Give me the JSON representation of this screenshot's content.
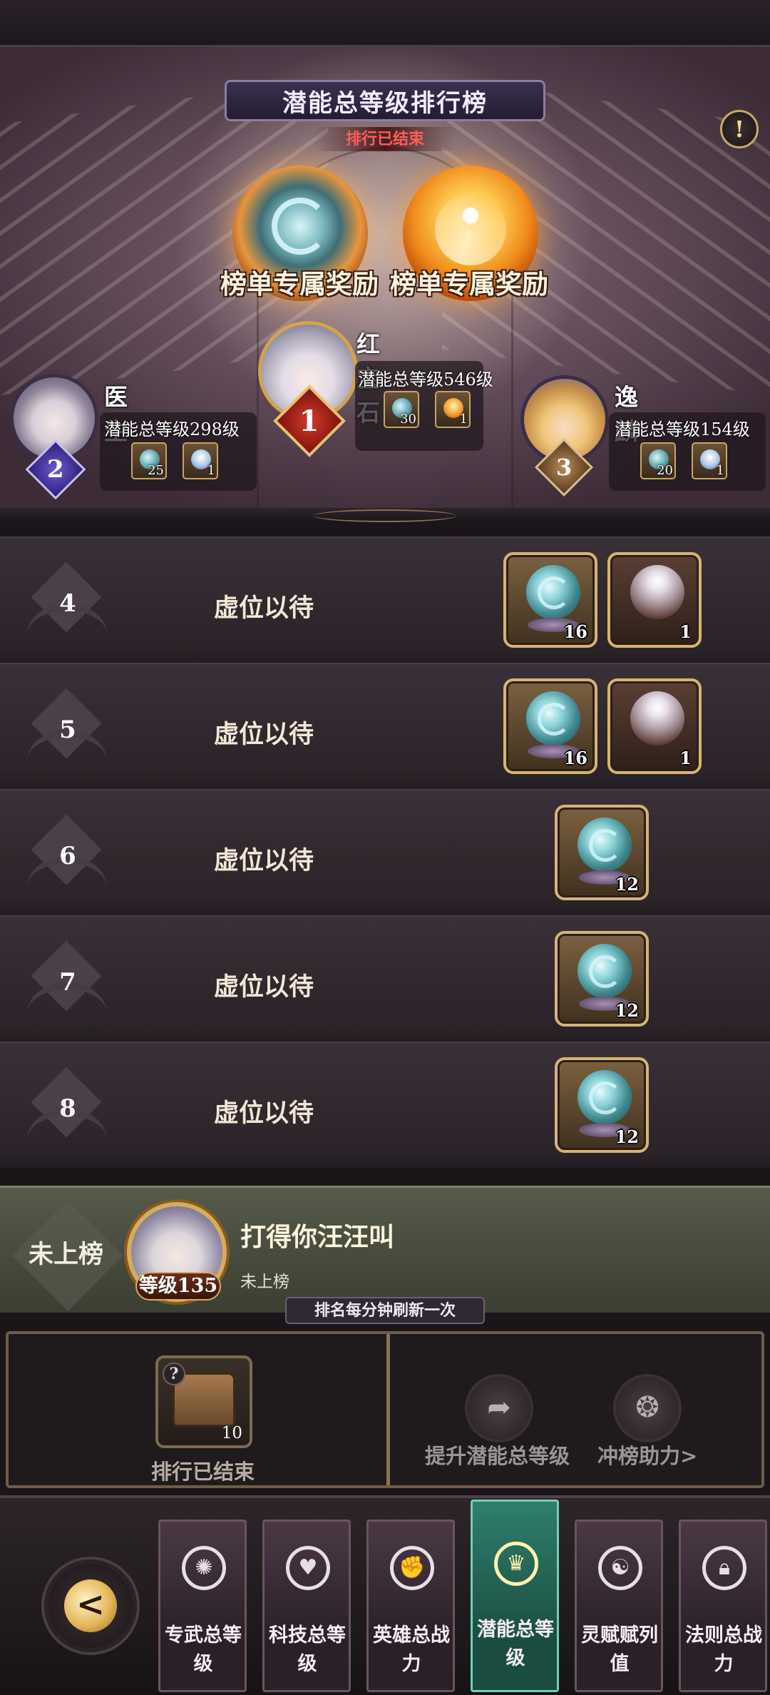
{
  "header": {
    "title": "潜能总等级排行榜",
    "status": "排行已结束"
  },
  "rewards": [
    {
      "label": "榜单专属奖励",
      "icon": "swirl-orb"
    },
    {
      "label": "榜单专属奖励",
      "icon": "golden-wings"
    }
  ],
  "podium": [
    {
      "rank": "1",
      "name": "红宝石",
      "level": "潜能总等级546级",
      "items": [
        {
          "icon": "swirl-orb",
          "count": "30"
        },
        {
          "icon": "golden-wings",
          "count": "1"
        }
      ]
    },
    {
      "rank": "2",
      "name": "医生",
      "level": "潜能总等级298级",
      "items": [
        {
          "icon": "swirl-orb",
          "count": "25"
        },
        {
          "icon": "blue-wings",
          "count": "1"
        }
      ]
    },
    {
      "rank": "3",
      "name": "逸麟",
      "level": "潜能总等级154级",
      "items": [
        {
          "icon": "swirl-orb",
          "count": "20"
        },
        {
          "icon": "blue-wings",
          "count": "1"
        }
      ]
    }
  ],
  "rows": [
    {
      "rank": "4",
      "label": "虚位以待",
      "rewards": [
        {
          "icon": "swirl-orb",
          "count": "16"
        },
        {
          "icon": "silver-wings",
          "count": "1"
        }
      ]
    },
    {
      "rank": "5",
      "label": "虚位以待",
      "rewards": [
        {
          "icon": "swirl-orb",
          "count": "16"
        },
        {
          "icon": "silver-wings",
          "count": "1"
        }
      ]
    },
    {
      "rank": "6",
      "label": "虚位以待",
      "rewards": [
        {
          "icon": "swirl-orb",
          "count": "12"
        }
      ]
    },
    {
      "rank": "7",
      "label": "虚位以待",
      "rewards": [
        {
          "icon": "swirl-orb",
          "count": "12"
        }
      ]
    },
    {
      "rank": "8",
      "label": "虚位以待",
      "rewards": [
        {
          "icon": "swirl-orb",
          "count": "12"
        }
      ]
    }
  ],
  "me": {
    "rank_text": "未上榜",
    "level": "等级135",
    "name": "打得你汪汪叫",
    "status": "未上榜"
  },
  "refresh_note": "排名每分钟刷新一次",
  "panel": {
    "chest_count": "10",
    "chest_label": "排行已结束",
    "chest_q": "?",
    "actions": [
      "提升潜能总等级",
      "冲榜助力>"
    ]
  },
  "nav": {
    "tabs": [
      {
        "label": "专武总等级",
        "icon": "swirl-gear-icon"
      },
      {
        "label": "科技总等级",
        "icon": "heart-wings-icon"
      },
      {
        "label": "英雄总战力",
        "icon": "fist-icon"
      },
      {
        "label": "潜能总等级",
        "icon": "crown-book-icon",
        "active": true
      },
      {
        "label": "灵赋赋列值",
        "icon": "spirit-icon"
      },
      {
        "label": "法则总战力",
        "icon": "lock-icon"
      }
    ]
  },
  "colors": {
    "accent_gold": "#d6b377",
    "status_red": "#ff5d5d",
    "active_tab": "#2f7f6c"
  }
}
